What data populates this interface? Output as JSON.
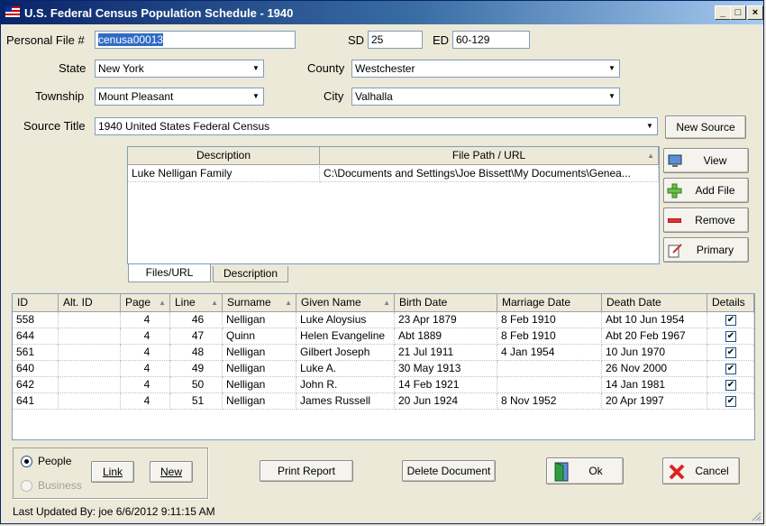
{
  "window": {
    "title": "U.S. Federal Census Population Schedule - 1940"
  },
  "form": {
    "personal_file_label": "Personal File #",
    "personal_file_value": "cenusa00013",
    "sd_label": "SD",
    "sd_value": "25",
    "ed_label": "ED",
    "ed_value": "60-129",
    "state_label": "State",
    "state_value": "New York",
    "county_label": "County",
    "county_value": "Westchester",
    "township_label": "Township",
    "township_value": "Mount Pleasant",
    "city_label": "City",
    "city_value": "Valhalla",
    "source_title_label": "Source Title",
    "source_title_value": "1940 United States Federal Census",
    "new_source_label": "New Source"
  },
  "files": {
    "col_description": "Description",
    "col_path": "File Path / URL",
    "rows": [
      {
        "description": "Luke Nelligan Family",
        "path": "C:\\Documents  and  Settings\\Joe  Bissett\\My  Documents\\Genea..."
      }
    ],
    "buttons": {
      "view": "View",
      "add_file": "Add File",
      "remove": "Remove",
      "primary": "Primary"
    },
    "tabs": [
      "Files/URL",
      "Description"
    ]
  },
  "people": {
    "columns": [
      "ID",
      "Alt. ID",
      "Page",
      "Line",
      "Surname",
      "Given Name",
      "Birth Date",
      "Marriage Date",
      "Death Date",
      "Details"
    ],
    "rows": [
      {
        "id": "558",
        "alt": "",
        "page": "4",
        "line": "46",
        "surname": "Nelligan",
        "given": "Luke Aloysius",
        "birth": "23 Apr 1879",
        "marriage": "8 Feb 1910",
        "death": "Abt 10 Jun 1954",
        "details": true
      },
      {
        "id": "644",
        "alt": "",
        "page": "4",
        "line": "47",
        "surname": "Quinn",
        "given": "Helen Evangeline",
        "birth": "Abt 1889",
        "marriage": "8 Feb 1910",
        "death": "Abt 20 Feb 1967",
        "details": true
      },
      {
        "id": "561",
        "alt": "",
        "page": "4",
        "line": "48",
        "surname": "Nelligan",
        "given": "Gilbert Joseph",
        "birth": "21 Jul 1911",
        "marriage": "4 Jan 1954",
        "death": "10 Jun 1970",
        "details": true
      },
      {
        "id": "640",
        "alt": "",
        "page": "4",
        "line": "49",
        "surname": "Nelligan",
        "given": "Luke A.",
        "birth": "30 May 1913",
        "marriage": "",
        "death": "26 Nov 2000",
        "details": true
      },
      {
        "id": "642",
        "alt": "",
        "page": "4",
        "line": "50",
        "surname": "Nelligan",
        "given": "John R.",
        "birth": "14 Feb 1921",
        "marriage": "",
        "death": "14 Jan 1981",
        "details": true
      },
      {
        "id": "641",
        "alt": "",
        "page": "4",
        "line": "51",
        "surname": "Nelligan",
        "given": "James Russell",
        "birth": "20 Jun 1924",
        "marriage": "8 Nov 1952",
        "death": "20 Apr 1997",
        "details": true
      }
    ]
  },
  "footer": {
    "people_label": "People",
    "business_label": "Business",
    "link_label": "Link",
    "new_label": "New",
    "print_report_label": "Print Report",
    "delete_document_label": "Delete Document",
    "ok_label": "Ok",
    "cancel_label": "Cancel",
    "last_updated": "Last Updated By: joe 6/6/2012 9:11:15 AM"
  },
  "colors": {
    "title_bar": "#0a246a",
    "selection": "#316ac5",
    "window_bg": "#ece9d8"
  }
}
